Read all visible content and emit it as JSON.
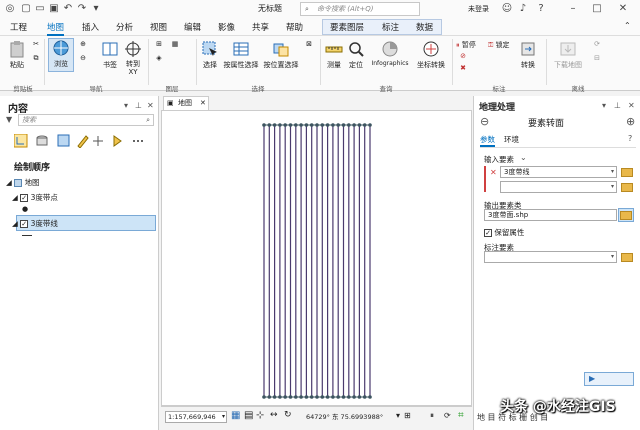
{
  "titlebar": {
    "title": "无标题",
    "search_placeholder": "命令搜索 (Alt+Q)",
    "user": "未登录"
  },
  "tabs": [
    "工程",
    "地图",
    "插入",
    "分析",
    "视图",
    "编辑",
    "影像",
    "共享",
    "帮助",
    "要素图层",
    "标注",
    "数据"
  ],
  "active_tab": "地图",
  "ribbon": {
    "buttons": {
      "paste": "粘贴",
      "explore": "浏览",
      "bookmark": "书签",
      "goto": "转到\nXY",
      "select": "选择",
      "select_by_attr": "按属性选择",
      "select_by_loc": "按位置选择",
      "measure": "测量",
      "locate": "定位",
      "infographics": "Infographics",
      "coord_conv": "坐标转换",
      "pause": "暂停",
      "lock": "锁定",
      "convert": "转换",
      "download_map": "下载地图"
    },
    "groups": [
      "剪贴板",
      "导航",
      "图层",
      "选择",
      "查询",
      "标注",
      "离线"
    ]
  },
  "contents": {
    "title": "内容",
    "search_placeholder": "搜索",
    "drawing_order": "绘制顺序",
    "map": "地图",
    "layers": [
      "3度带点",
      "3度带线"
    ]
  },
  "map_view": {
    "tab_label": "地图",
    "scale": "1:157,669,946",
    "coords": "64729° 东  75.6993988°"
  },
  "geoprocessing": {
    "title": "地理处理",
    "tool_title": "要素转面",
    "tabs": [
      "参数",
      "环境"
    ],
    "input_features_label": "输入要素",
    "input_feature_value": "3度带线",
    "output_label": "输出要素类",
    "output_value": "3度带面.shp",
    "preserve_attr_label": "保留属性",
    "label_features_label": "标注要素",
    "bottom_tabs": "地 目 符 标 栅 创 目"
  },
  "watermark": "头条 @水经注GIS",
  "colors": {
    "accent": "#0070c0",
    "selected": "#cde4f7",
    "map_line": "#4a3a6e"
  }
}
